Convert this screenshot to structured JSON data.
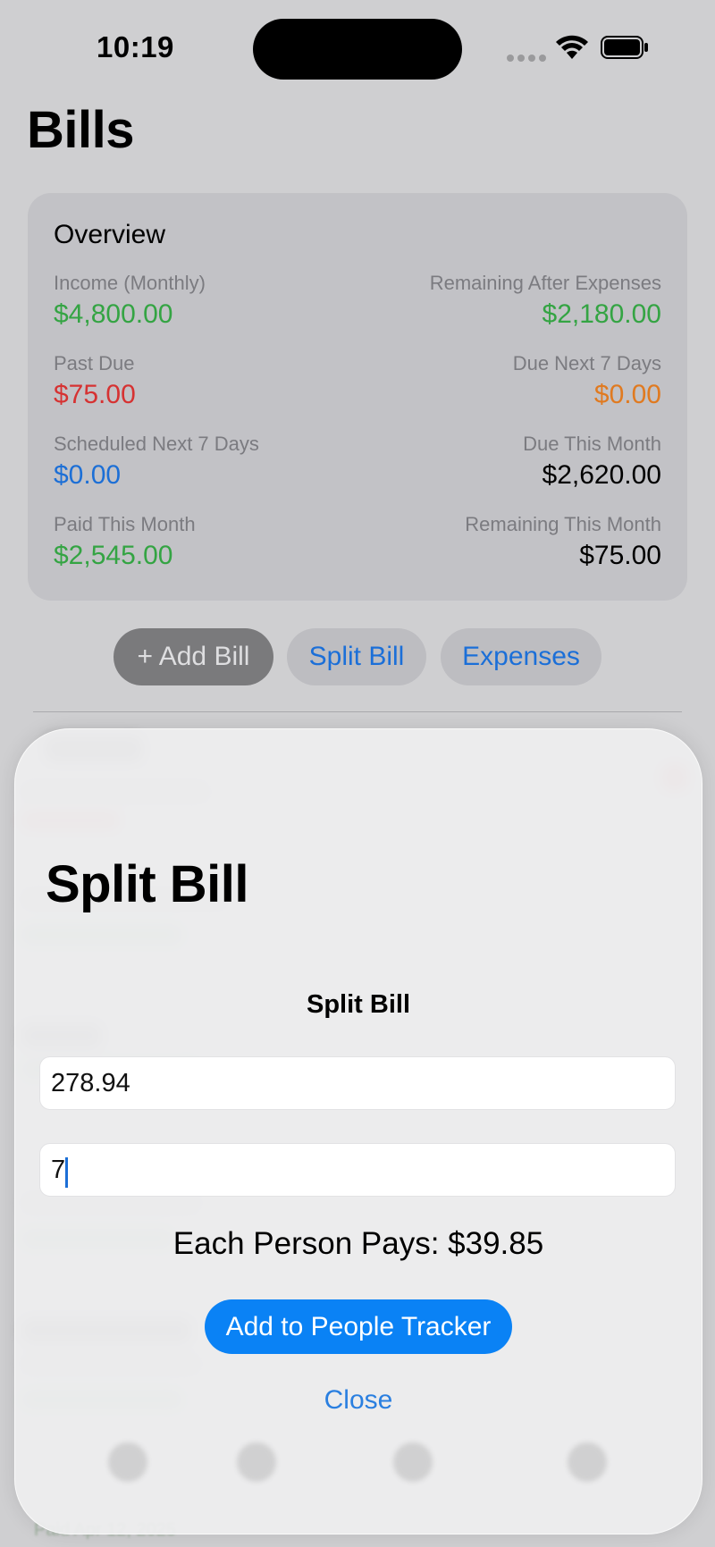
{
  "status_bar": {
    "time": "10:19"
  },
  "page": {
    "title": "Bills"
  },
  "overview": {
    "title": "Overview",
    "rows": [
      {
        "left": {
          "label": "Income (Monthly)",
          "value": "$4,800.00",
          "color": "#34a443"
        },
        "right": {
          "label": "Remaining After Expenses",
          "value": "$2,180.00",
          "color": "#34a443"
        }
      },
      {
        "left": {
          "label": "Past Due",
          "value": "$75.00",
          "color": "#d63232"
        },
        "right": {
          "label": "Due Next 7 Days",
          "value": "$0.00",
          "color": "#e07a20"
        }
      },
      {
        "left": {
          "label": "Scheduled Next 7 Days",
          "value": "$0.00",
          "color": "#1c6fd6"
        },
        "right": {
          "label": "Due This Month",
          "value": "$2,620.00",
          "color": "#000000"
        }
      },
      {
        "left": {
          "label": "Paid This Month",
          "value": "$2,545.00",
          "color": "#34a443"
        },
        "right": {
          "label": "Remaining This Month",
          "value": "$75.00",
          "color": "#000000"
        }
      }
    ]
  },
  "actions": {
    "add_bill": "+ Add Bill",
    "split_bill": "Split Bill",
    "expenses": "Expenses"
  },
  "background_peek": {
    "partial_text": "Paid Apr 12, 2025"
  },
  "split_sheet": {
    "title": "Split Bill",
    "form_title": "Split Bill",
    "amount_value": "278.94",
    "people_value": "7",
    "each_pays": "Each Person Pays: $39.85",
    "add_button": "Add to People Tracker",
    "close_button": "Close"
  },
  "colors": {
    "accent": "#0a82f5",
    "link": "#2a7fe0",
    "green": "#34a443",
    "red": "#d63232",
    "orange": "#e07a20"
  }
}
